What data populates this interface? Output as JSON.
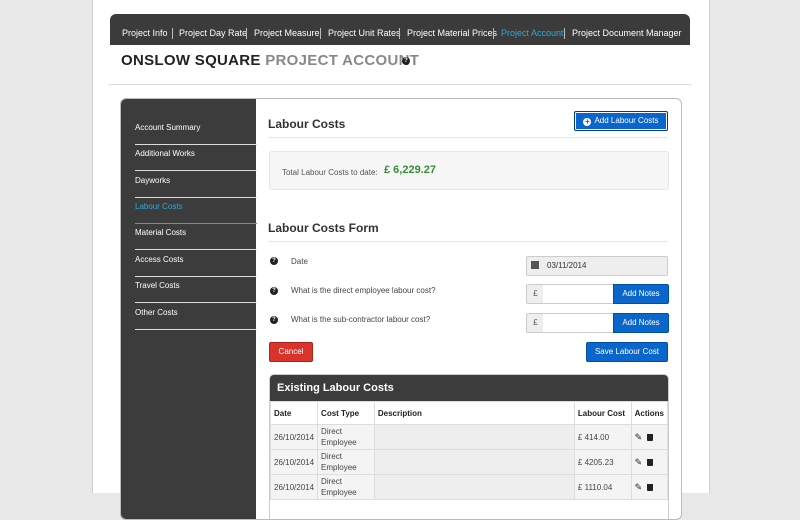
{
  "nav": {
    "items": [
      "Project Info",
      "Project Day Rate",
      "Project Measure",
      "Project Unit Rates",
      "Project Material Prices",
      "Project Account",
      "Project Document Manager"
    ],
    "active": "Project Account"
  },
  "header": {
    "title_main": "ONSLOW SQUARE",
    "title_sub": "PROJECT ACCOUNT"
  },
  "sidebar": {
    "items": [
      "Account Summary",
      "Additional Works",
      "Dayworks",
      "Labour Costs",
      "Material Costs",
      "Access Costs",
      "Travel Costs",
      "Other Costs"
    ],
    "active": "Labour Costs"
  },
  "labour": {
    "heading": "Labour Costs",
    "add_button": "Add Labour Costs",
    "total_label": "Total Labour Costs to date:",
    "total_value": "£ 6,229.27"
  },
  "form": {
    "heading": "Labour Costs Form",
    "date_label": "Date",
    "date_value": "03/11/2014",
    "direct_label": "What is the direct employee labour cost?",
    "sub_label": "What is the sub-contractor labour cost?",
    "currency": "£",
    "notes_button": "Add Notes",
    "cancel_button": "Cancel",
    "save_button": "Save Labour Cost"
  },
  "existing": {
    "title": "Existing Labour Costs",
    "columns": [
      "Date",
      "Cost Type",
      "Description",
      "Labour Cost",
      "Actions"
    ],
    "rows": [
      {
        "date": "26/10/2014",
        "type1": "Direct",
        "type2": "Employee",
        "desc": "",
        "cost": "£ 414.00"
      },
      {
        "date": "26/10/2014",
        "type1": "Direct",
        "type2": "Employee",
        "desc": "",
        "cost": "£ 4205.23"
      },
      {
        "date": "26/10/2014",
        "type1": "Direct",
        "type2": "Employee",
        "desc": "",
        "cost": "£ 1110.04"
      }
    ]
  },
  "colors": {
    "accent_blue": "#0b66cc",
    "active_link": "#29a9e0",
    "dark_bar": "#3c3c3c",
    "total_green": "#3a8a3a",
    "cancel_red": "#d9342b"
  }
}
